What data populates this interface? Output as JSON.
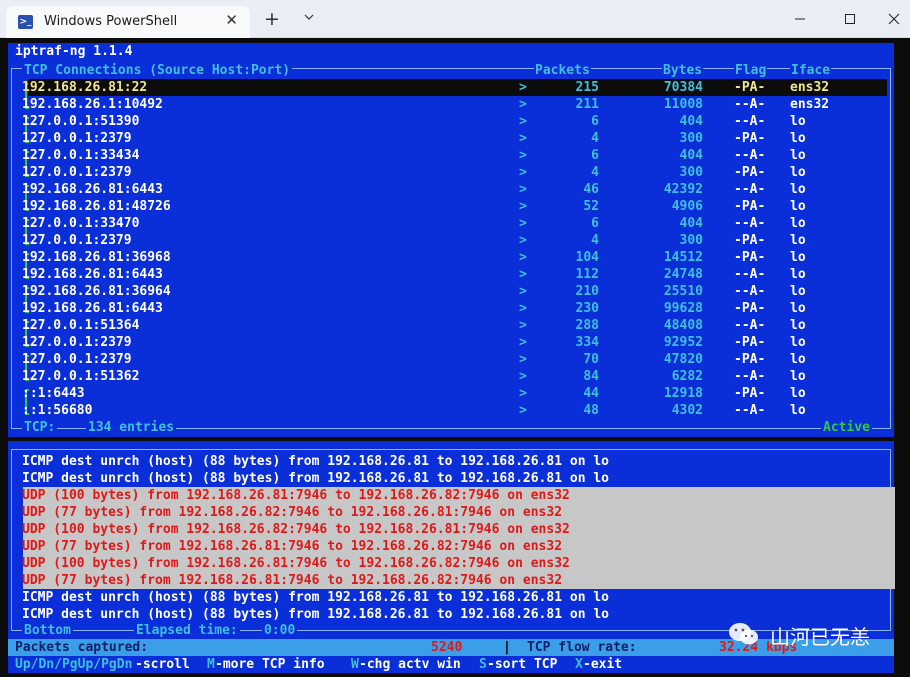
{
  "window": {
    "tab_title": "Windows PowerShell",
    "tab_icon": "powershell-icon",
    "newtab_icon": "plus-icon",
    "dropdown_icon": "chevron-down-icon",
    "controls": [
      "minimize-icon",
      "maximize-icon",
      "close-icon"
    ]
  },
  "app": {
    "title": "iptraf-ng 1.1.4"
  },
  "tcp": {
    "columns": {
      "conn": "TCP Connections (Source Host:Port)",
      "packets": "Packets",
      "bytes": "Bytes",
      "flag": "Flag",
      "iface": "Iface"
    },
    "rows": [
      {
        "host": "192.168.26.81:22",
        "dir": ">",
        "packets": "215",
        "bytes": "70384",
        "flag": "-PA-",
        "iface": "ens32"
      },
      {
        "host": "192.168.26.1:10492",
        "dir": ">",
        "packets": "211",
        "bytes": "11008",
        "flag": "--A-",
        "iface": "ens32"
      },
      {
        "host": "127.0.0.1:51390",
        "dir": ">",
        "packets": "6",
        "bytes": "404",
        "flag": "--A-",
        "iface": "lo"
      },
      {
        "host": "127.0.0.1:2379",
        "dir": ">",
        "packets": "4",
        "bytes": "300",
        "flag": "-PA-",
        "iface": "lo"
      },
      {
        "host": "127.0.0.1:33434",
        "dir": ">",
        "packets": "6",
        "bytes": "404",
        "flag": "--A-",
        "iface": "lo"
      },
      {
        "host": "127.0.0.1:2379",
        "dir": ">",
        "packets": "4",
        "bytes": "300",
        "flag": "-PA-",
        "iface": "lo"
      },
      {
        "host": "192.168.26.81:6443",
        "dir": ">",
        "packets": "46",
        "bytes": "42392",
        "flag": "--A-",
        "iface": "lo"
      },
      {
        "host": "192.168.26.81:48726",
        "dir": ">",
        "packets": "52",
        "bytes": "4906",
        "flag": "-PA-",
        "iface": "lo"
      },
      {
        "host": "127.0.0.1:33470",
        "dir": ">",
        "packets": "6",
        "bytes": "404",
        "flag": "--A-",
        "iface": "lo"
      },
      {
        "host": "127.0.0.1:2379",
        "dir": ">",
        "packets": "4",
        "bytes": "300",
        "flag": "-PA-",
        "iface": "lo"
      },
      {
        "host": "192.168.26.81:36968",
        "dir": ">",
        "packets": "104",
        "bytes": "14512",
        "flag": "-PA-",
        "iface": "lo"
      },
      {
        "host": "192.168.26.81:6443",
        "dir": ">",
        "packets": "112",
        "bytes": "24748",
        "flag": "--A-",
        "iface": "lo"
      },
      {
        "host": "192.168.26.81:36964",
        "dir": ">",
        "packets": "210",
        "bytes": "25510",
        "flag": "--A-",
        "iface": "lo"
      },
      {
        "host": "192.168.26.81:6443",
        "dir": ">",
        "packets": "230",
        "bytes": "99628",
        "flag": "-PA-",
        "iface": "lo"
      },
      {
        "host": "127.0.0.1:51364",
        "dir": ">",
        "packets": "288",
        "bytes": "48408",
        "flag": "--A-",
        "iface": "lo"
      },
      {
        "host": "127.0.0.1:2379",
        "dir": ">",
        "packets": "334",
        "bytes": "92952",
        "flag": "-PA-",
        "iface": "lo"
      },
      {
        "host": "127.0.0.1:2379",
        "dir": ">",
        "packets": "70",
        "bytes": "47820",
        "flag": "-PA-",
        "iface": "lo"
      },
      {
        "host": "127.0.0.1:51362",
        "dir": ">",
        "packets": "84",
        "bytes": "6282",
        "flag": "--A-",
        "iface": "lo"
      },
      {
        "host": "::1:6443",
        "dir": ">",
        "packets": "44",
        "bytes": "12918",
        "flag": "-PA-",
        "iface": "lo"
      },
      {
        "host": "::1:56680",
        "dir": ">",
        "packets": "48",
        "bytes": "4302",
        "flag": "--A-",
        "iface": "lo"
      }
    ],
    "footer_label": "TCP:",
    "footer_entries": "134 entries",
    "footer_status": "Active"
  },
  "other": {
    "lines": [
      "ICMP dest unrch (host) (88 bytes) from 192.168.26.81 to 192.168.26.81 on lo",
      "ICMP dest unrch (host) (88 bytes) from 192.168.26.81 to 192.168.26.81 on lo",
      "UDP (100 bytes) from 192.168.26.81:7946 to 192.168.26.82:7946 on ens32",
      "UDP (77 bytes) from 192.168.26.82:7946 to 192.168.26.81:7946 on ens32",
      "UDP (100 bytes) from 192.168.26.82:7946 to 192.168.26.81:7946 on ens32",
      "UDP (77 bytes) from 192.168.26.81:7946 to 192.168.26.82:7946 on ens32",
      "UDP (100 bytes) from 192.168.26.81:7946 to 192.168.26.82:7946 on ens32",
      "UDP (77 bytes) from 192.168.26.81:7946 to 192.168.26.82:7946 on ens32",
      "ICMP dest unrch (host) (88 bytes) from 192.168.26.81 to 192.168.26.81 on lo",
      "ICMP dest unrch (host) (88 bytes) from 192.168.26.81 to 192.168.26.81 on lo"
    ],
    "footer_bottom": "Bottom",
    "footer_elapsed_label": "Elapsed time:",
    "footer_elapsed_value": "0:00"
  },
  "status": {
    "captured_label": "Packets captured:",
    "captured_value": "5240",
    "separator": "|",
    "flow_label": "TCP flow rate:",
    "flow_value": "32.24 kbps"
  },
  "keys": [
    {
      "key": "Up/Dn/PgUp/PgDn",
      "desc": "-scroll"
    },
    {
      "key": "M",
      "desc": "-more TCP info"
    },
    {
      "key": "W",
      "desc": "-chg actv win"
    },
    {
      "key": "S",
      "desc": "-sort TCP"
    },
    {
      "key": "X",
      "desc": "-exit"
    }
  ],
  "watermark": {
    "icon": "wechat-icon",
    "text": "山河已无恙"
  }
}
